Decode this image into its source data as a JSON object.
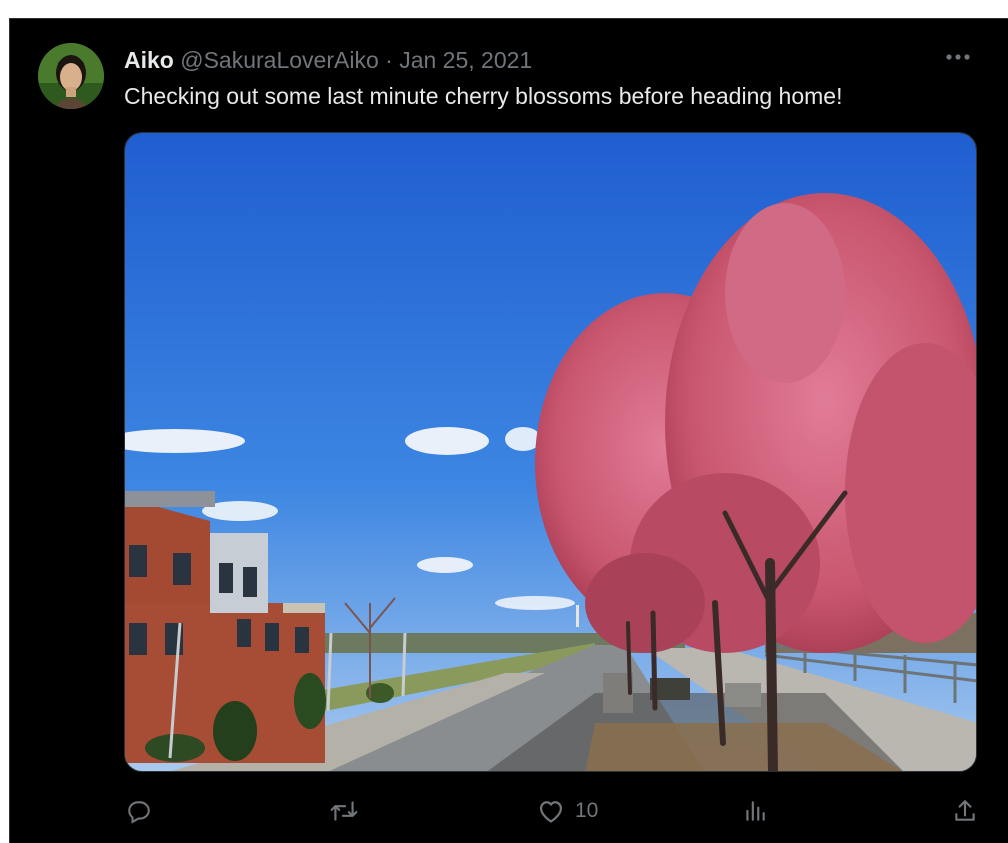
{
  "tweet": {
    "author_name": "Aiko",
    "handle": "@SakuraLoverAiko",
    "separator": "·",
    "date": "Jan 25, 2021",
    "text": "Checking out some last minute cherry blossoms before heading home!",
    "likes_count": "10"
  },
  "icons": {
    "more": "more-horizontal-icon",
    "reply": "reply-icon",
    "retweet": "retweet-icon",
    "like": "heart-icon",
    "views": "analytics-icon",
    "share": "share-icon"
  },
  "colors": {
    "background": "#000000",
    "primary_text": "#e7e9ea",
    "secondary_text": "#71767b",
    "border": "#2f3336"
  }
}
